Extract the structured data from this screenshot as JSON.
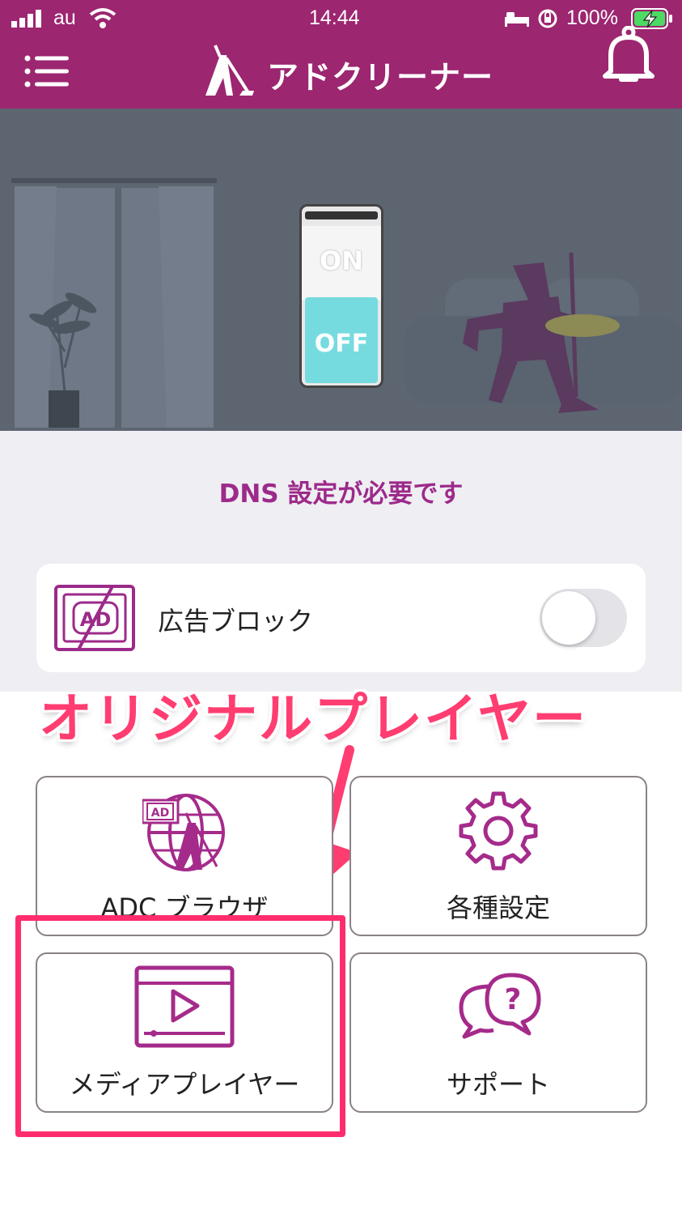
{
  "status_bar": {
    "carrier": "au",
    "time": "14:44",
    "battery_percent": "100%"
  },
  "header": {
    "app_title": "アドクリーナー",
    "menu_icon": "hamburger-menu-icon",
    "notification_icon": "bell-icon"
  },
  "hero": {
    "switch_on_label": "ON",
    "switch_off_label": "OFF",
    "switch_state": "off"
  },
  "dns_notice": "DNS 設定が必要です",
  "ad_block": {
    "label": "広告ブロック",
    "icon_text": "AD",
    "enabled": false
  },
  "annotation": {
    "callout": "オリジナルプレイヤー"
  },
  "tiles": [
    {
      "label": "ADC ブラウザ",
      "icon": "globe-browser-icon",
      "badge_text": "AD"
    },
    {
      "label": "各種設定",
      "icon": "gear-icon"
    },
    {
      "label": "メディアプレイヤー",
      "icon": "video-player-icon"
    },
    {
      "label": "サポート",
      "icon": "help-chat-icon",
      "badge_text": "?"
    }
  ],
  "colors": {
    "brand": "#9c2670",
    "accent_pink": "#ff3d71",
    "hero_bg": "#5d6571",
    "switch_cyan": "#76dbdf"
  }
}
